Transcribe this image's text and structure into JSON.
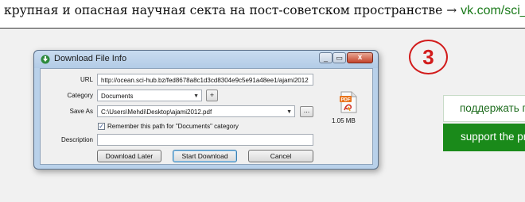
{
  "page": {
    "headline": "крупная и опасная научная секта на пост-советском пространстве →",
    "headline_link": "vk.com/sci_hub",
    "step_number": "3",
    "support_outline": "поддержать п",
    "support_filled": "support the pr"
  },
  "dialog": {
    "title": "Download File Info",
    "controls": {
      "minimize": "_",
      "maximize": "▭",
      "close": "x"
    },
    "url_label": "URL",
    "url_value": "http://ocean.sci-hub.bz/fed8678a8c1d3cd8304e9c5e91a48ee1/ajami2012",
    "category_label": "Category",
    "category_value": "Documents",
    "add_category": "+",
    "saveas_label": "Save As",
    "saveas_value": "C:\\Users\\Mehdi\\Desktop\\ajami2012.pdf",
    "browse": "...",
    "remember_label": "Remember this path for \"Documents\" category",
    "remember_checked": true,
    "description_label": "Description",
    "description_value": "",
    "file_size": "1.05 MB",
    "buttons": {
      "later": "Download Later",
      "start": "Start Download",
      "cancel": "Cancel"
    }
  },
  "colors": {
    "link": "#1a7a1a",
    "step": "#d21c1c",
    "support_green": "#1a8a1a"
  }
}
